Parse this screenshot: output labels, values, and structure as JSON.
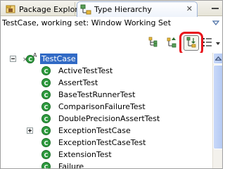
{
  "tabs": [
    {
      "label": "Package Explorer",
      "icon": "package-explorer-icon",
      "active": false
    },
    {
      "label": "Type Hierarchy",
      "icon": "type-hierarchy-icon",
      "active": true
    }
  ],
  "tab_close_glyph": "✕",
  "description": "TestCase, working set: Window Working Set",
  "toolbar": {
    "buttons": [
      {
        "name": "show-type-hierarchy",
        "icon": "type-hierarchy-tree-icon",
        "pressed": false
      },
      {
        "name": "show-supertype-hierarchy",
        "icon": "supertype-hierarchy-icon",
        "pressed": false
      },
      {
        "name": "show-subtype-hierarchy",
        "icon": "subtype-hierarchy-icon",
        "pressed": true
      },
      {
        "name": "layout-menu",
        "icon": "layout-menu-icon",
        "pressed": false
      }
    ],
    "highlight_color": "#e8151c"
  },
  "tree": {
    "root": {
      "label": "TestCase",
      "icon": "abstract-class-icon",
      "overlay": "A",
      "expanded": true,
      "selected": true
    },
    "children": [
      {
        "label": "ActiveTestTest",
        "icon": "class-icon",
        "expandable": false
      },
      {
        "label": "AssertTest",
        "icon": "class-icon",
        "expandable": false
      },
      {
        "label": "BaseTestRunnerTest",
        "icon": "class-icon",
        "expandable": false
      },
      {
        "label": "ComparisonFailureTest",
        "icon": "class-icon",
        "expandable": false
      },
      {
        "label": "DoublePrecisionAssertTest",
        "icon": "class-icon",
        "expandable": false
      },
      {
        "label": "ExceptionTestCase",
        "icon": "class-icon",
        "expandable": true
      },
      {
        "label": "ExceptionTestCaseTest",
        "icon": "class-icon",
        "expandable": false
      },
      {
        "label": "ExtensionTest",
        "icon": "class-icon",
        "expandable": false
      },
      {
        "label": "Failure",
        "icon": "class-icon",
        "expandable": false
      }
    ]
  },
  "colors": {
    "selection": "#316ac5",
    "class_green": "#2e9b3e",
    "tab_border": "#9fb4d8"
  }
}
